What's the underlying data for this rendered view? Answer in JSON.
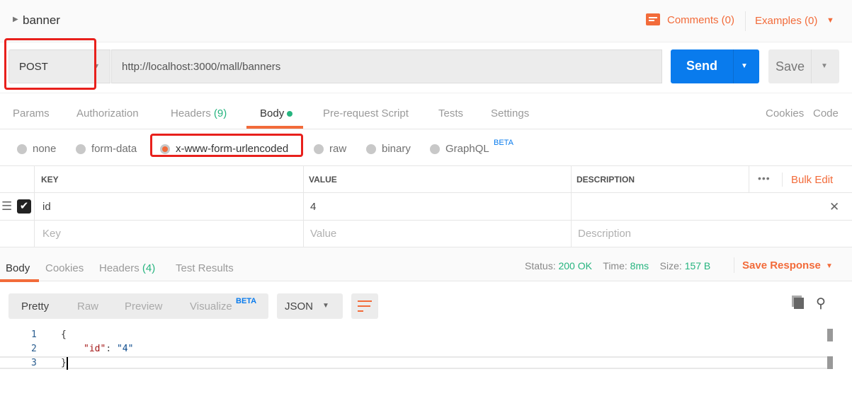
{
  "request": {
    "name": "banner",
    "method": "POST",
    "url": "http://localhost:3000/mall/banners",
    "comments": "Comments (0)",
    "examples": "Examples (0)",
    "send": "Send",
    "save": "Save"
  },
  "req_tabs": {
    "params": "Params",
    "authorization": "Authorization",
    "headers": "Headers",
    "headers_count": "(9)",
    "body": "Body",
    "prerequest": "Pre-request Script",
    "tests": "Tests",
    "settings": "Settings",
    "cookies": "Cookies",
    "code": "Code"
  },
  "body_modes": {
    "none": "none",
    "form_data": "form-data",
    "urlencoded": "x-www-form-urlencoded",
    "raw": "raw",
    "binary": "binary",
    "graphql": "GraphQL",
    "beta": "BETA",
    "selected": "x-www-form-urlencoded"
  },
  "table": {
    "headers": [
      "KEY",
      "VALUE",
      "DESCRIPTION"
    ],
    "bulk_edit": "Bulk Edit",
    "rows": [
      {
        "checked": true,
        "key": "id",
        "value": "4",
        "description": ""
      }
    ],
    "placeholders": {
      "key": "Key",
      "value": "Value",
      "description": "Description"
    }
  },
  "response": {
    "tabs": {
      "body": "Body",
      "cookies": "Cookies",
      "headers": "Headers",
      "headers_count": "(4)",
      "tests": "Test Results"
    },
    "status_label": "Status:",
    "status": "200 OK",
    "time_label": "Time:",
    "time": "8ms",
    "size_label": "Size:",
    "size": "157 B",
    "save_response": "Save Response",
    "views": {
      "pretty": "Pretty",
      "raw": "Raw",
      "preview": "Preview",
      "visualize": "Visualize",
      "beta": "BETA"
    },
    "format": "JSON",
    "lines": [
      {
        "n": "1",
        "text": "{"
      },
      {
        "n": "2",
        "key": "\"id\"",
        "sep": ": ",
        "val": "\"4\""
      },
      {
        "n": "3",
        "text": "}"
      }
    ]
  },
  "colors": {
    "accent": "#f26b3a",
    "send": "#097bed",
    "success": "#26b47f",
    "annotation": "#e8201c"
  }
}
